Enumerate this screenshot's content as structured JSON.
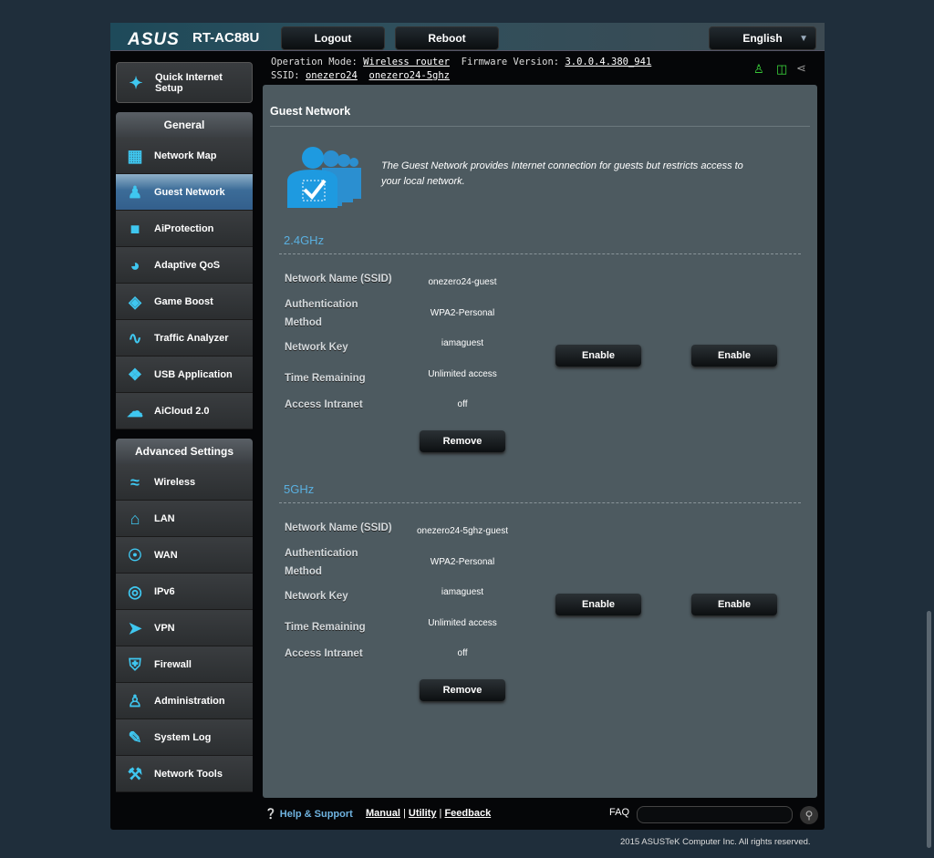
{
  "header": {
    "brand": "ASUS",
    "model": "RT-AC88U",
    "logout": "Logout",
    "reboot": "Reboot",
    "language": "English"
  },
  "status": {
    "op_mode_label": "Operation Mode:",
    "op_mode": "Wireless router",
    "fw_label": "Firmware Version:",
    "fw": "3.0.0.4.380_941",
    "ssid_label": "SSID:",
    "ssid1": "onezero24",
    "ssid2": "onezero24-5ghz",
    "icons": [
      "user-icon",
      "network-icon",
      "usb-icon"
    ],
    "active_color": "#3ddc3d"
  },
  "sidebar": {
    "quick_setup": "Quick Internet Setup",
    "general": "General",
    "general_items": [
      {
        "label": "Network Map",
        "icon": "network-map-icon"
      },
      {
        "label": "Guest Network",
        "icon": "guest-icon",
        "selected": true
      },
      {
        "label": "AiProtection",
        "icon": "lock-icon"
      },
      {
        "label": "Adaptive QoS",
        "icon": "gauge-icon"
      },
      {
        "label": "Game Boost",
        "icon": "gamepad-icon"
      },
      {
        "label": "Traffic Analyzer",
        "icon": "chart-icon"
      },
      {
        "label": "USB Application",
        "icon": "puzzle-icon"
      },
      {
        "label": "AiCloud 2.0",
        "icon": "cloud-icon"
      }
    ],
    "advanced": "Advanced Settings",
    "advanced_items": [
      {
        "label": "Wireless",
        "icon": "wifi-icon"
      },
      {
        "label": "LAN",
        "icon": "home-icon"
      },
      {
        "label": "WAN",
        "icon": "globe-icon"
      },
      {
        "label": "IPv6",
        "icon": "ipv6-icon"
      },
      {
        "label": "VPN",
        "icon": "vpn-icon"
      },
      {
        "label": "Firewall",
        "icon": "shield-icon"
      },
      {
        "label": "Administration",
        "icon": "admin-icon"
      },
      {
        "label": "System Log",
        "icon": "log-icon"
      },
      {
        "label": "Network Tools",
        "icon": "tools-icon"
      }
    ]
  },
  "main": {
    "title": "Guest Network",
    "description": "The Guest Network provides Internet connection for guests but restricts access to your local network.",
    "labels": {
      "ssid": "Network Name (SSID)",
      "auth1": "Authentication",
      "auth2": "Method",
      "key": "Network Key",
      "time": "Time Remaining",
      "intranet": "Access Intranet"
    },
    "enable": "Enable",
    "remove": "Remove",
    "bands": [
      {
        "name": "2.4GHz",
        "ssid": "onezero24-guest",
        "auth": "WPA2-Personal",
        "key": "iamaguest",
        "time": "Unlimited access",
        "intranet": "off"
      },
      {
        "name": "5GHz",
        "ssid": "onezero24-5ghz-guest",
        "auth": "WPA2-Personal",
        "key": "iamaguest",
        "time": "Unlimited access",
        "intranet": "off"
      }
    ]
  },
  "footer": {
    "help": "Help & Support",
    "manual": "Manual",
    "utility": "Utility",
    "feedback": "Feedback",
    "faq": "FAQ",
    "copyright": "2015 ASUSTeK Computer Inc. All rights reserved."
  }
}
